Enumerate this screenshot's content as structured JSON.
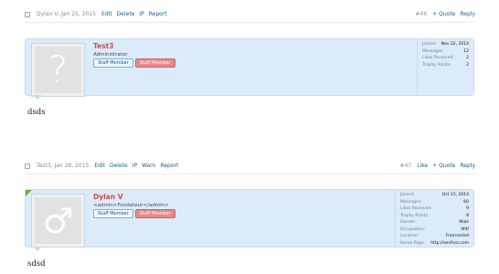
{
  "posts": [
    {
      "bar": {
        "author_date": "Dylan V, Jan 25, 2015",
        "actions": [
          "Edit",
          "Delete",
          "IP",
          "Report"
        ],
        "number": "#46",
        "right_actions": [
          "+ Quote",
          "Reply"
        ]
      },
      "user": {
        "name": "Test3",
        "title": "Administrator",
        "staff_badge": "Staff Member",
        "admin_badge": "Staff Member",
        "avatar_glyph": "?",
        "stats": [
          {
            "label": "Joined:",
            "value": "Nov 22, 2014"
          },
          {
            "label": "Messages:",
            "value": "12"
          },
          {
            "label": "Likes Received:",
            "value": "2"
          },
          {
            "label": "Trophy Points:",
            "value": "2"
          }
        ]
      },
      "message": "dsds"
    },
    {
      "bar": {
        "author_date": "Test3, Jan 28, 2015",
        "actions": [
          "Edit",
          "Delete",
          "IP",
          "Warn",
          "Report"
        ],
        "number": "#47",
        "right_actions": [
          "Like",
          "+ Quote",
          "Reply"
        ]
      },
      "user": {
        "name": "Dylan V",
        "title": "<admin>Fondateur</admin>",
        "staff_badge": "Staff Member",
        "admin_badge": "Staff Member",
        "avatar_glyph": "♂",
        "stats": [
          {
            "label": "Joined:",
            "value": "Oct 15, 2014"
          },
          {
            "label": "Messages:",
            "value": "60"
          },
          {
            "label": "Likes Received:",
            "value": "9"
          },
          {
            "label": "Trophy Points:",
            "value": "8"
          },
          {
            "label": "Gender:",
            "value": "Male"
          },
          {
            "label": "Occupation:",
            "value": "dfdf"
          },
          {
            "label": "Location:",
            "value": "Francesdsd"
          },
          {
            "label": "Home Page:",
            "value": "http://xenforo.com"
          }
        ]
      },
      "message": "sdsd"
    }
  ],
  "colors": {
    "link": "#176093",
    "card_bg": "#dbebfa",
    "username": "#d14c4c",
    "admin_badge": "#e48a8a",
    "new_flag": "#6fb13f"
  }
}
